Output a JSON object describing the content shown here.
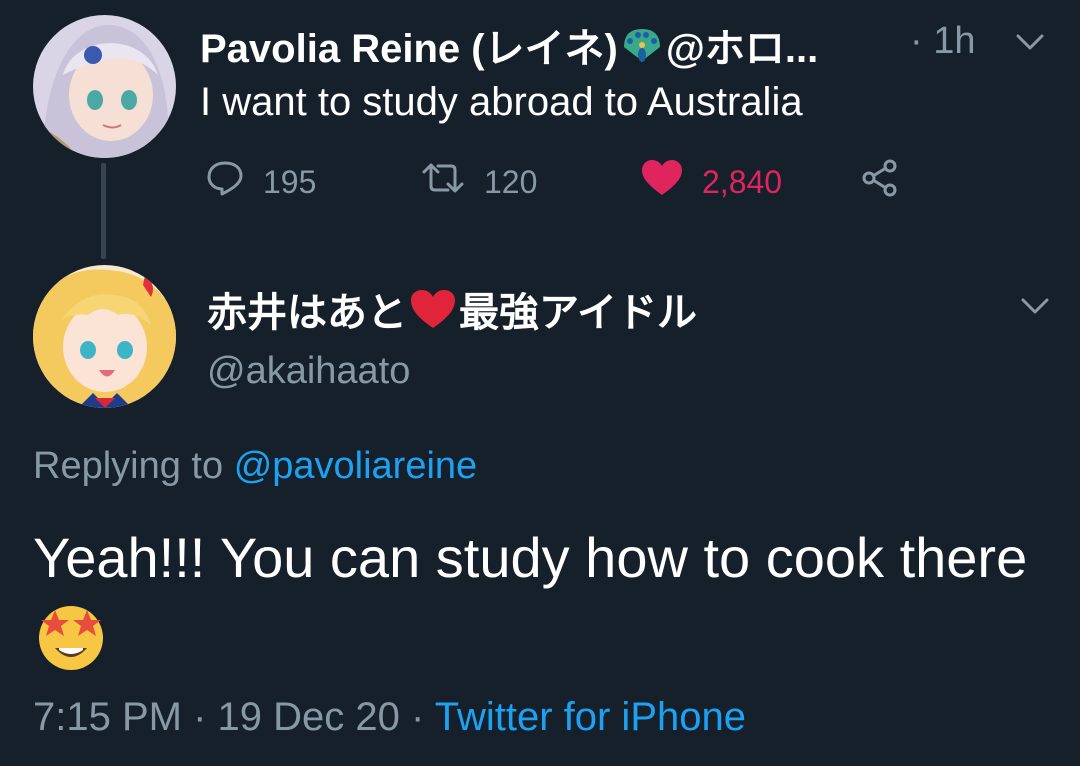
{
  "top_tweet": {
    "display_name": "Pavolia Reine (レイネ)",
    "handle_truncated": "@ホロ...",
    "time": "· 1h",
    "text": "I want to study abroad to Australia",
    "replies": "195",
    "retweets": "120",
    "likes": "2,840"
  },
  "reply_tweet": {
    "display_name_part1": "赤井はあと",
    "display_name_part2": "最強アイドル",
    "handle": "@akaihaato",
    "replying_prefix": "Replying to",
    "replying_mention": "@pavoliareine",
    "text": "Yeah!!! You can study how to cook there",
    "time": "7:15 PM",
    "date": "19 Dec 20",
    "separator": "·",
    "source": "Twitter for iPhone"
  },
  "colors": {
    "background": "#15202b",
    "text": "#ffffff",
    "muted": "#8899a6",
    "link": "#1da1f2",
    "like": "#e0245e"
  },
  "icons": [
    "reply-icon",
    "retweet-icon",
    "heart-icon",
    "share-icon",
    "chevron-down-icon",
    "peacock-emoji",
    "red-heart-emoji",
    "star-struck-emoji"
  ]
}
